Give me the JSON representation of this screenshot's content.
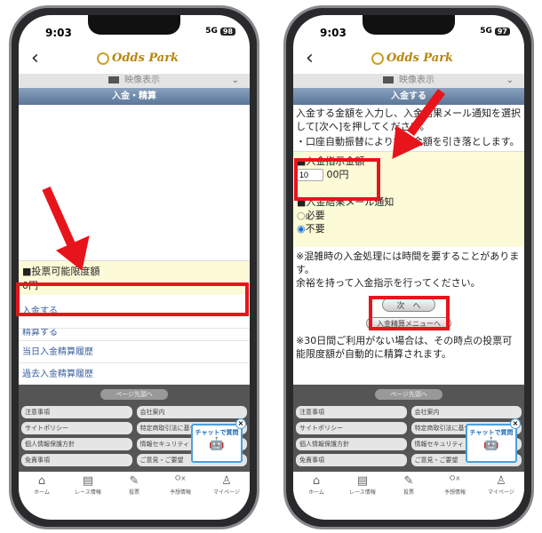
{
  "phones": [
    {
      "status": {
        "time": "9:03",
        "network": "5G",
        "battery": "98"
      },
      "logo": "Odds Park",
      "logo_sub": "オッズパーク",
      "video_label": "映像表示",
      "title": "入金・精算",
      "balance_label": "■投票可能限度額",
      "balance_value": "0円",
      "links": [
        "入金する",
        "精算する",
        "当日入金精算履歴",
        "過去入金精算履歴"
      ]
    },
    {
      "status": {
        "time": "9:03",
        "network": "5G",
        "battery": "97"
      },
      "logo": "Odds Park",
      "video_label": "映像表示",
      "title": "入金する",
      "intro": "入金する金額を入力し、入金結果メール通知を選択して[次へ]を押してください。",
      "intro2": "・口座自動振替により指定金額を引き落とします。",
      "amount_label": "■入金指示金額",
      "amount_value": "10",
      "amount_unit": "00円",
      "mail_label": "■入金結果メール通知",
      "mail_options": [
        "必要",
        "不要"
      ],
      "mail_selected": "不要",
      "note1": "※混雑時の入金処理には時間を要することがあります。",
      "note2": "余裕を持って入金指示を行ってください。",
      "next_button": "次　へ",
      "menu_button": "入金精算メニューへ",
      "note3": "※30日間ご利用がない場合は、その時点の投票可能限度額が自動的に精算されます。"
    }
  ],
  "footer": {
    "page_top": "ページ先頭へ",
    "links": [
      "注意事項",
      "会社案内",
      "サイトポリシー",
      "特定商取引法に基づく表示",
      "個人情報保護方針",
      "情報セキュリティ",
      "免責事項",
      "ご意見・ご要望"
    ],
    "chat": "チャットで質問",
    "chat_close": "×"
  },
  "tabbar": [
    {
      "label": "ホーム",
      "icon": "home-icon"
    },
    {
      "label": "レース情報",
      "icon": "document-icon"
    },
    {
      "label": "投票",
      "icon": "edit-icon"
    },
    {
      "label": "予想情報",
      "icon": "prediction-icon"
    },
    {
      "label": "マイページ",
      "icon": "user-icon"
    }
  ],
  "colors": {
    "annotation": "#e8141c",
    "title_bar": "#5a7699",
    "link": "#3a5fa0",
    "highlight": "#fdfbd7"
  }
}
